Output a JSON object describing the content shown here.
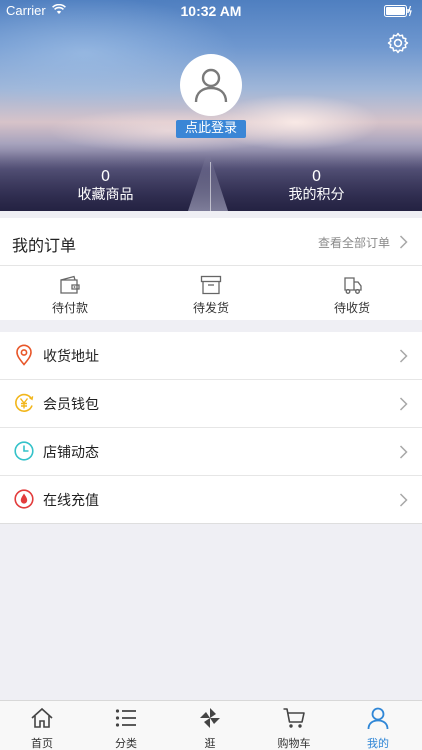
{
  "status_bar": {
    "carrier": "Carrier",
    "time": "10:32 AM"
  },
  "profile": {
    "login_label": "点此登录",
    "stats": [
      {
        "value": "0",
        "label": "收藏商品"
      },
      {
        "value": "0",
        "label": "我的积分"
      }
    ]
  },
  "orders": {
    "title": "我的订单",
    "view_all": "查看全部订单",
    "items": [
      {
        "label": "待付款",
        "icon": "wallet-icon"
      },
      {
        "label": "待发货",
        "icon": "box-icon"
      },
      {
        "label": "待收货",
        "icon": "truck-icon"
      }
    ]
  },
  "menu": {
    "items": [
      {
        "label": "收货地址",
        "icon": "location-pin-icon",
        "color": "#e8572a"
      },
      {
        "label": "会员钱包",
        "icon": "yen-coin-icon",
        "color": "#f2b61b"
      },
      {
        "label": "店铺动态",
        "icon": "clock-icon",
        "color": "#34c2c9"
      },
      {
        "label": "在线充值",
        "icon": "recharge-drop-icon",
        "color": "#e23c3c"
      }
    ]
  },
  "tabbar": {
    "active_color": "#2f86d6",
    "tabs": [
      {
        "label": "首页",
        "icon": "home-icon"
      },
      {
        "label": "分类",
        "icon": "list-icon"
      },
      {
        "label": "逛",
        "icon": "pinwheel-icon"
      },
      {
        "label": "购物车",
        "icon": "cart-icon"
      },
      {
        "label": "我的",
        "icon": "user-icon",
        "active": true
      }
    ]
  }
}
